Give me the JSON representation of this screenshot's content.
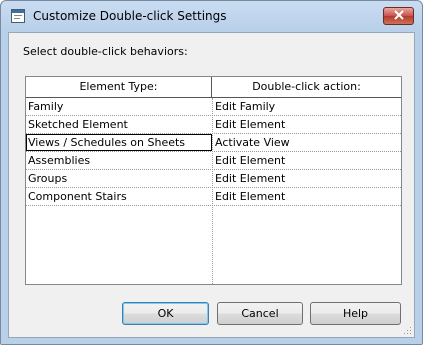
{
  "window": {
    "title": "Customize Double-click Settings"
  },
  "prompt": "Select double-click behaviors:",
  "table": {
    "headers": [
      "Element Type:",
      "Double-click action:"
    ],
    "rows": [
      {
        "element": "Family",
        "action": "Edit Family"
      },
      {
        "element": "Sketched Element",
        "action": "Edit Element"
      },
      {
        "element": "Views / Schedules on Sheets",
        "action": "Activate View"
      },
      {
        "element": "Assemblies",
        "action": "Edit Element"
      },
      {
        "element": "Groups",
        "action": "Edit Element"
      },
      {
        "element": "Component Stairs",
        "action": "Edit Element"
      }
    ],
    "focused_row": 2
  },
  "buttons": {
    "ok": "OK",
    "cancel": "Cancel",
    "help": "Help"
  },
  "icons": {
    "app": "window-app-icon",
    "close": "close-icon",
    "grip": "resize-grip-icon"
  },
  "colors": {
    "close_button": "#c75050",
    "titlebar": "#c9dcf1",
    "default_button_border": "#3c7fb1"
  }
}
